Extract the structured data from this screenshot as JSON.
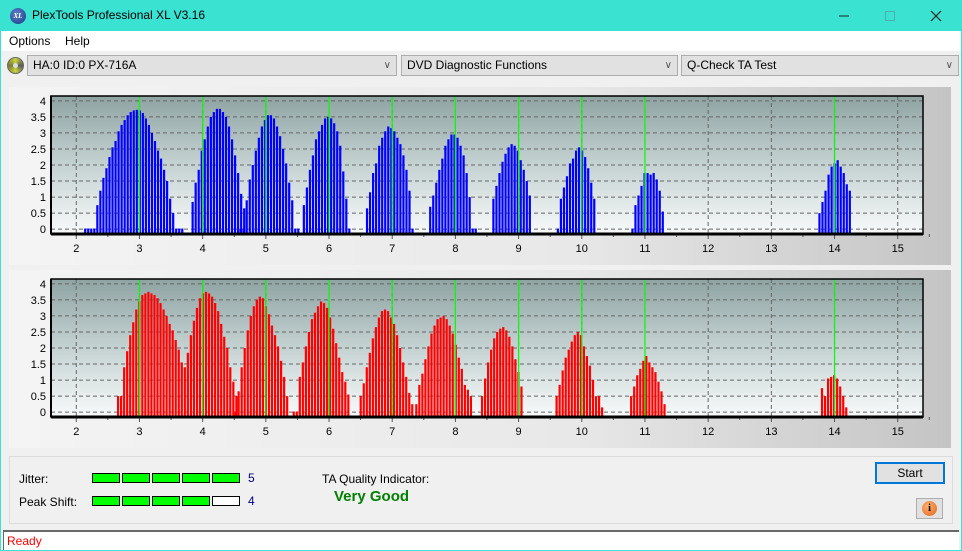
{
  "window": {
    "title": "PlexTools Professional XL V3.16",
    "icon_label": "XL",
    "controls": [
      "minimize",
      "maximize",
      "close"
    ]
  },
  "menu": {
    "items": [
      "Options",
      "Help"
    ]
  },
  "toolbar": {
    "drive": "HA:0 ID:0  PX-716A",
    "function": "DVD Diagnostic Functions",
    "test": "Q-Check TA Test"
  },
  "colors": {
    "titlebar": "#3ae2d2",
    "land_bars": "#0000ff",
    "pit_bars": "#ff0000",
    "marker_lines": "#00ff00",
    "quality_text": "#008000",
    "status_text": "#ff0000"
  },
  "chart_data": [
    {
      "type": "bar",
      "name": "ta-top-chart",
      "bar_color": "#0000ff",
      "xlim": [
        1.6,
        15.4
      ],
      "ylim": [
        -0.15,
        4.15
      ],
      "x_ticks": [
        2,
        3,
        4,
        5,
        6,
        7,
        8,
        9,
        10,
        11,
        12,
        13,
        14,
        15
      ],
      "y_ticks": [
        0,
        0.5,
        1,
        1.5,
        2,
        2.5,
        3,
        3.5,
        4
      ],
      "y_tick_labels": [
        "0",
        "0.5",
        "1",
        "1.5",
        "2",
        "2.5",
        "3",
        "3.5",
        "4"
      ],
      "markers": [
        3,
        4,
        5,
        6,
        7,
        8,
        9,
        10,
        11,
        14
      ],
      "grid": true,
      "step": 0.048,
      "peaks": [
        {
          "start": 2.14,
          "values": [
            0,
            0,
            0,
            0,
            0.75,
            1.2,
            1.6,
            1.9,
            2.25,
            2.55,
            2.75,
            3.05,
            3.25,
            3.4,
            3.55,
            3.65,
            3.7,
            3.72,
            3.7,
            3.62,
            3.45,
            3.25,
            3.0,
            2.75,
            2.45,
            2.2,
            1.85,
            1.5,
            0.95,
            0.5,
            0,
            0,
            0
          ]
        },
        {
          "start": 3.84,
          "values": [
            0.85,
            1.45,
            1.85,
            2.45,
            2.8,
            3.2,
            3.5,
            3.65,
            3.75,
            3.75,
            3.65,
            3.5,
            3.2,
            2.8,
            2.3,
            1.75,
            1.1,
            0.65
          ]
        },
        {
          "start": 4.6,
          "values": [
            0,
            0,
            0.9,
            1.55,
            2.0,
            2.45,
            2.85,
            3.2,
            3.4,
            3.55,
            3.55,
            3.45,
            3.2,
            2.9,
            2.5,
            2.05,
            1.45,
            0.9,
            0,
            0
          ]
        },
        {
          "start": 5.6,
          "values": [
            0.75,
            1.3,
            1.85,
            2.3,
            2.8,
            3.05,
            3.25,
            3.45,
            3.5,
            3.45,
            3.3,
            3.05,
            2.6,
            1.8,
            0.95,
            0
          ]
        },
        {
          "start": 6.6,
          "values": [
            0.65,
            1.15,
            1.75,
            2.05,
            2.6,
            2.85,
            3.05,
            3.2,
            3.15,
            3.05,
            2.85,
            2.65,
            2.3,
            1.85,
            1.2,
            0
          ]
        },
        {
          "start": 7.6,
          "values": [
            0.7,
            1.05,
            1.45,
            1.85,
            2.2,
            2.6,
            2.8,
            2.95,
            2.95,
            2.85,
            2.6,
            2.3,
            1.75,
            1.0,
            0,
            0
          ]
        },
        {
          "start": 8.6,
          "values": [
            0.95,
            1.35,
            1.75,
            2.1,
            2.35,
            2.55,
            2.65,
            2.6,
            2.45,
            2.15,
            1.85,
            1.5,
            1.05
          ]
        },
        {
          "start": 9.62,
          "values": [
            0,
            0.95,
            1.3,
            1.65,
            2.05,
            2.2,
            2.45,
            2.55,
            2.45,
            2.25,
            1.9,
            1.45,
            0.95
          ]
        },
        {
          "start": 10.8,
          "values": [
            0,
            0.75,
            1.05,
            1.35,
            1.75,
            1.75,
            1.7,
            1.75,
            1.55,
            1.2,
            0.55
          ]
        },
        {
          "start": 13.76,
          "values": [
            0.5,
            0.85,
            1.2,
            1.7,
            1.95,
            2.05,
            2.15,
            1.95,
            1.75,
            1.4,
            1.2
          ]
        }
      ]
    },
    {
      "type": "bar",
      "name": "ta-bottom-chart",
      "bar_color": "#ff0000",
      "xlim": [
        1.6,
        15.4
      ],
      "ylim": [
        -0.15,
        4.15
      ],
      "x_ticks": [
        2,
        3,
        4,
        5,
        6,
        7,
        8,
        9,
        10,
        11,
        12,
        13,
        14,
        15
      ],
      "y_ticks": [
        0,
        0.5,
        1,
        1.5,
        2,
        2.5,
        3,
        3.5,
        4
      ],
      "y_tick_labels": [
        "0",
        "0.5",
        "1",
        "1.5",
        "2",
        "2.5",
        "3",
        "3.5",
        "4"
      ],
      "markers": [
        3,
        4,
        5,
        6,
        7,
        8,
        9,
        10,
        11,
        14
      ],
      "grid": true,
      "step": 0.048,
      "peaks": [
        {
          "start": 2.66,
          "values": [
            0.5,
            0.5,
            1.4,
            1.9,
            2.4,
            2.8,
            3.2,
            3.45,
            3.65,
            3.7,
            3.75,
            3.7,
            3.65,
            3.55,
            3.4,
            3.2,
            3.0,
            2.75,
            2.55,
            2.25,
            1.95,
            1.55,
            1.4,
            1.85,
            2.4,
            2.85,
            3.25,
            3.55,
            3.7,
            3.75,
            3.7,
            3.6,
            3.4,
            3.15,
            2.75,
            2.35,
            2.0,
            1.4,
            0.95,
            0.5
          ]
        },
        {
          "start": 4.52,
          "values": [
            0,
            0.65,
            1.4,
            2.0,
            2.55,
            3.0,
            3.3,
            3.5,
            3.6,
            3.55,
            3.3,
            3.05,
            2.7,
            2.4,
            2.05,
            1.6,
            1.1,
            0.5
          ]
        },
        {
          "start": 5.44,
          "values": [
            0,
            0,
            1.1,
            1.55,
            2.05,
            2.5,
            2.9,
            3.1,
            3.3,
            3.45,
            3.4,
            3.25,
            2.95,
            2.6,
            2.15,
            1.7,
            1.25,
            0.95,
            0.55
          ]
        },
        {
          "start": 6.5,
          "values": [
            0.5,
            0.9,
            1.4,
            1.85,
            2.3,
            2.65,
            2.95,
            3.15,
            3.2,
            3.15,
            2.95,
            2.75,
            2.4,
            2.0,
            1.55,
            1.1,
            0.6,
            0.25
          ]
        },
        {
          "start": 7.38,
          "values": [
            0.25,
            0.85,
            1.2,
            1.65,
            2.05,
            2.45,
            2.7,
            2.9,
            2.95,
            3.0,
            2.9,
            2.7,
            2.45,
            2.1,
            1.7,
            1.35,
            0.85,
            0.7,
            0.5
          ]
        },
        {
          "start": 8.42,
          "values": [
            0.5,
            1.05,
            1.55,
            1.95,
            2.3,
            2.5,
            2.6,
            2.65,
            2.55,
            2.35,
            2.05,
            1.65,
            1.25,
            0.8
          ]
        },
        {
          "start": 9.6,
          "values": [
            0.5,
            0.85,
            1.3,
            1.7,
            1.95,
            2.2,
            2.4,
            2.5,
            2.4,
            2.05,
            1.75,
            1.45,
            1.0,
            0.5,
            0.5,
            0.15
          ]
        },
        {
          "start": 10.78,
          "values": [
            0.5,
            0.8,
            1.15,
            1.35,
            1.6,
            1.75,
            1.55,
            1.4,
            1.25,
            0.95,
            0.65,
            0.25
          ]
        },
        {
          "start": 13.8,
          "values": [
            0.75,
            0.5,
            1.05,
            1.1,
            1.15,
            1.05,
            0.8,
            0.5,
            0.15
          ]
        }
      ]
    }
  ],
  "metrics": {
    "jitter": {
      "label": "Jitter:",
      "value": 5,
      "max": 5
    },
    "peak_shift": {
      "label": "Peak Shift:",
      "value": 4,
      "max": 5
    },
    "ta_quality_label": "TA Quality Indicator:",
    "ta_quality_value": "Very Good"
  },
  "buttons": {
    "start": "Start",
    "info": "i"
  },
  "status": {
    "text": "Ready"
  }
}
